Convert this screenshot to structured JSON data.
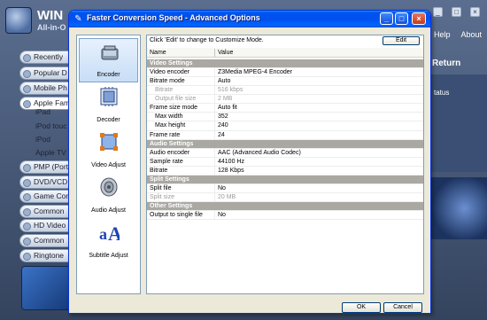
{
  "background_app": {
    "title": "WIN",
    "subtitle": "All-in-O",
    "menu": [
      "Help",
      "About"
    ],
    "return_label": "Return",
    "status_label": "tatus",
    "categories": [
      {
        "label": "Recently"
      },
      {
        "label": "Popular D"
      },
      {
        "label": "Mobile Ph"
      },
      {
        "label": "Apple Fam"
      },
      {
        "label": "PMP (Port"
      },
      {
        "label": "DVD/VCD"
      },
      {
        "label": "Game Con"
      },
      {
        "label": "Common"
      },
      {
        "label": "HD Video"
      },
      {
        "label": "Common"
      },
      {
        "label": "Ringtone"
      }
    ],
    "apple_sub": [
      "iPad",
      "iPod touc",
      "iPod",
      "Apple TV"
    ]
  },
  "dialog": {
    "title": "Faster Conversion Speed - Advanced Options",
    "hint": "Click 'Edit' to change to Customize Mode.",
    "edit_label": "Edit",
    "ok_label": "OK",
    "cancel_label": "Cancel",
    "columns": {
      "name": "Name",
      "value": "Value"
    },
    "sidebar": [
      {
        "label": "Encoder",
        "icon": "encoder-icon",
        "selected": true
      },
      {
        "label": "Decoder",
        "icon": "decoder-icon",
        "selected": false
      },
      {
        "label": "Video Adjust",
        "icon": "video-adjust-icon",
        "selected": false
      },
      {
        "label": "Audio Adjust",
        "icon": "audio-adjust-icon",
        "selected": false
      },
      {
        "label": "Subtitle Adjust",
        "icon": "subtitle-adjust-icon",
        "selected": false
      }
    ],
    "rows": [
      {
        "type": "section",
        "name": "Video Settings"
      },
      {
        "name": "Video encoder",
        "value": "Z3Media MPEG-4 Encoder"
      },
      {
        "name": "Bitrate mode",
        "value": "Auto"
      },
      {
        "name": "Bitrate",
        "value": "516 kbps",
        "indent": true,
        "disabled": true
      },
      {
        "name": "Output file size",
        "value": "2 MB",
        "indent": true,
        "disabled": true
      },
      {
        "name": "Frame size mode",
        "value": "Auto fit"
      },
      {
        "name": "Max width",
        "value": "352",
        "indent": true
      },
      {
        "name": "Max height",
        "value": "240",
        "indent": true
      },
      {
        "name": "Frame rate",
        "value": "24"
      },
      {
        "type": "section",
        "name": "Audio Settings"
      },
      {
        "name": "Audio encoder",
        "value": "AAC (Advanced Audio Codec)"
      },
      {
        "name": "Sample rate",
        "value": "44100 Hz"
      },
      {
        "name": "Bitrate",
        "value": "128 Kbps"
      },
      {
        "type": "section",
        "name": "Split Settings"
      },
      {
        "name": "Split file",
        "value": "No"
      },
      {
        "name": "Split size",
        "value": "20 MB",
        "disabled": true
      },
      {
        "type": "section",
        "name": "Other Settings"
      },
      {
        "name": "Output to single file",
        "value": "No"
      }
    ]
  },
  "colors": {
    "titlebar": "#0053ee",
    "section_bg": "#aaa8a2",
    "dialog_bg": "#ece9d8",
    "selected_item": "#c8ddf6"
  }
}
